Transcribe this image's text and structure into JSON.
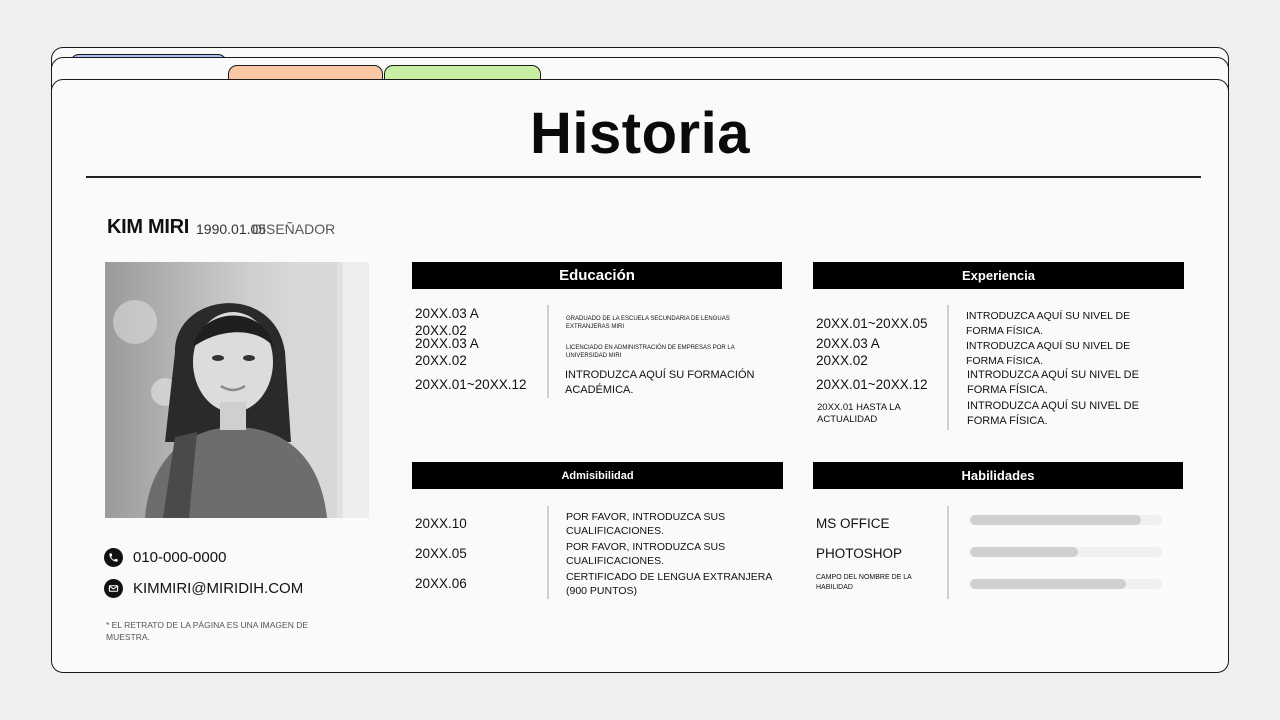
{
  "title": "Historia",
  "profile": {
    "name": "KIM MIRI",
    "birth": "1990.01.05",
    "role": "DISEÑADOR",
    "phone": "010-000-0000",
    "email": "KIMMIRI@MIRIDIH.COM",
    "note": "* EL RETRATO DE LA PÁGINA ES UNA IMAGEN DE MUESTRA."
  },
  "education": {
    "header": "Educación",
    "dates": [
      "20XX.03 A 20XX.02",
      "20XX.03 A 20XX.02",
      "20XX.01~20XX.12"
    ],
    "items": [
      "GRADUADO DE LA ESCUELA SECUNDARIA DE LENGUAS EXTRANJERAS MIRI",
      "LICENCIADO EN ADMINISTRACIÓN DE EMPRESAS POR LA UNIVERSIDAD MIRI",
      "INTRODUZCA AQUÍ SU FORMACIÓN ACADÉMICA."
    ]
  },
  "experience": {
    "header": "Experiencia",
    "dates": [
      "20XX.01~20XX.05",
      "20XX.03 A 20XX.02",
      "20XX.01~20XX.12",
      "20XX.01 HASTA LA ACTUALIDAD"
    ],
    "items": [
      "INTRODUZCA AQUÍ SU NIVEL DE FORMA FÍSICA.",
      "INTRODUZCA AQUÍ SU NIVEL DE FORMA FÍSICA.",
      "INTRODUZCA AQUÍ SU NIVEL DE FORMA FÍSICA.",
      "INTRODUZCA AQUÍ SU NIVEL DE FORMA FÍSICA."
    ]
  },
  "eligibility": {
    "header": "Admisibilidad",
    "dates": [
      "20XX.10",
      "20XX.05",
      "20XX.06"
    ],
    "items": [
      "POR FAVOR, INTRODUZCA SUS CUALIFICACIONES.",
      "POR FAVOR, INTRODUZCA SUS CUALIFICACIONES.",
      "CERTIFICADO DE LENGUA EXTRANJERA (900 PUNTOS)"
    ]
  },
  "skills": {
    "header": "Habilidades",
    "items": [
      {
        "name": "MS OFFICE",
        "level": 0.89
      },
      {
        "name": "PHOTOSHOP",
        "level": 0.56
      },
      {
        "name": "CAMPO DEL NOMBRE DE LA HABILIDAD",
        "level": 0.81
      }
    ]
  },
  "colors": {
    "tab_blue": "#a8c3f3",
    "tab_orange": "#f9c7a3",
    "tab_green": "#c8eea3",
    "header_bg": "#000000",
    "skill_fill": "#cfcfcf"
  }
}
